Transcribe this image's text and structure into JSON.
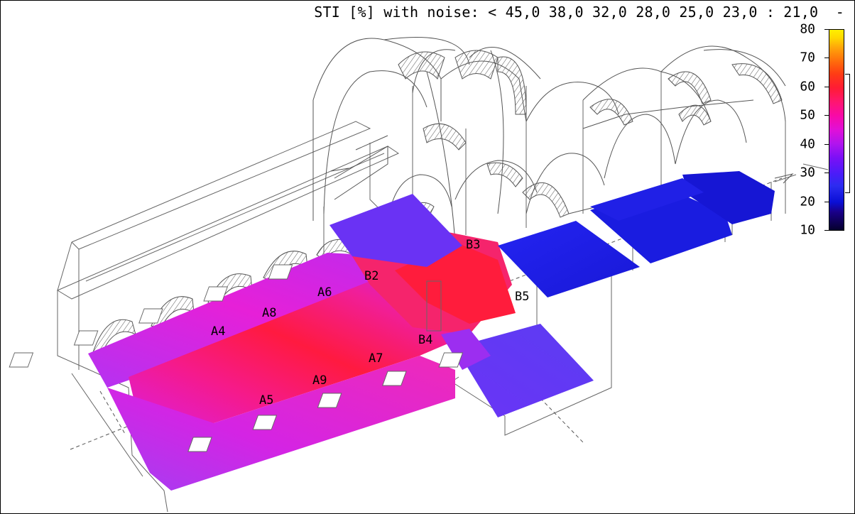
{
  "title": "STI [%] with noise: < 45,0 38,0 32,0 28,0 25,0 23,0 : 21,0  -",
  "colorbar": {
    "ticks": [
      "80",
      "70",
      "60",
      "50",
      "40",
      "30",
      "20",
      "10"
    ],
    "colors": [
      "#fff000",
      "#ff6a0c",
      "#ff1c34",
      "#f80aa8",
      "#7a10f6",
      "#2c2cf0",
      "#0a0fd6",
      "#06002e"
    ]
  },
  "receivers": [
    {
      "label": "A4"
    },
    {
      "label": "A8"
    },
    {
      "label": "A6"
    },
    {
      "label": "A5"
    },
    {
      "label": "A9"
    },
    {
      "label": "A7"
    },
    {
      "label": "B2"
    },
    {
      "label": "B3"
    },
    {
      "label": "B4"
    },
    {
      "label": "B5"
    }
  ]
}
